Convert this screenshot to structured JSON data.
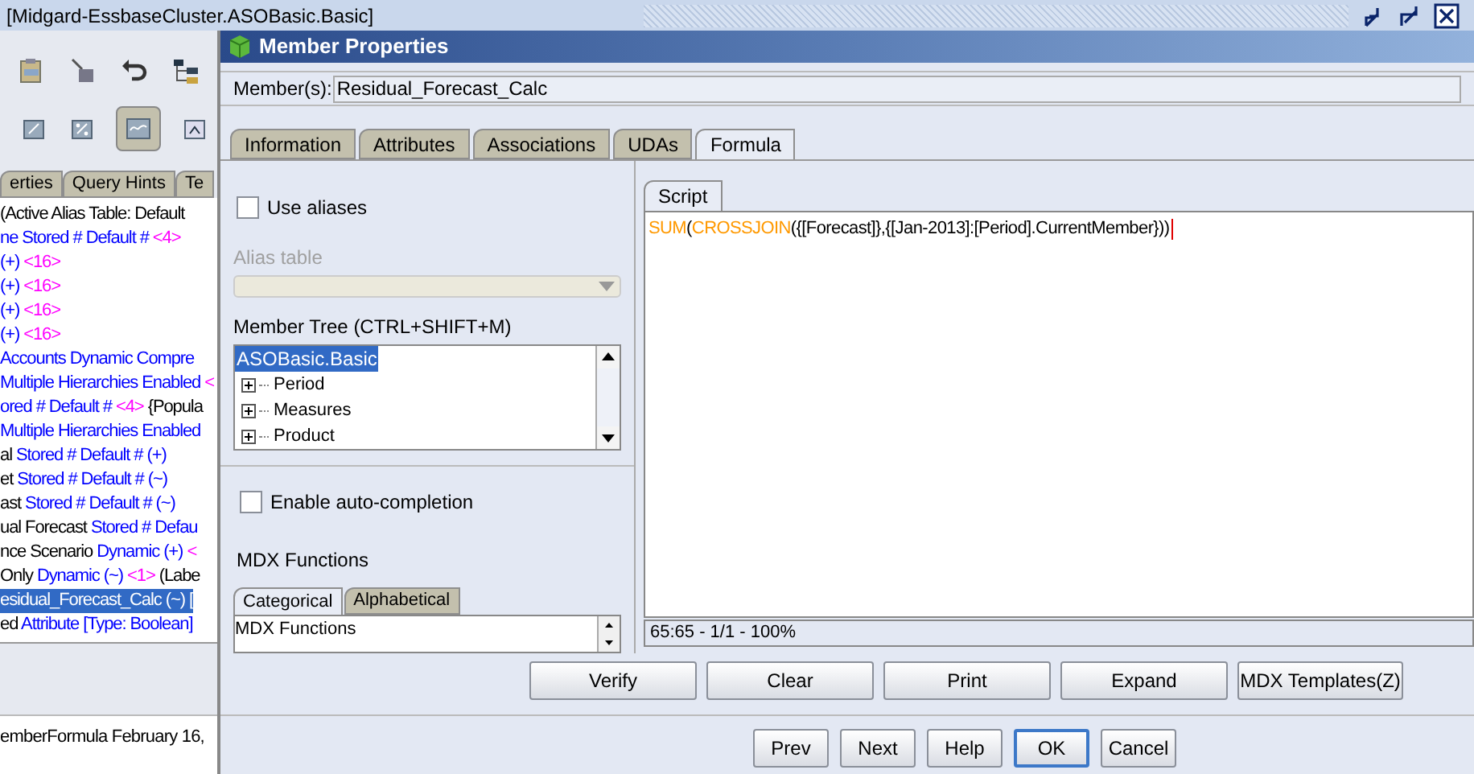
{
  "app": {
    "title": "[Midgard-EssbaseCluster.ASOBasic.Basic]",
    "panel_tabs": [
      {
        "label": "erties",
        "selected": false
      },
      {
        "label": "Query Hints",
        "selected": false
      },
      {
        "label": "Te",
        "selected": false
      }
    ],
    "outline": [
      {
        "selected": false,
        "segments": [
          {
            "text": "(Active Alias Table: Default",
            "color": "#000000"
          }
        ]
      },
      {
        "selected": false,
        "segments": [
          {
            "text": "ne Stored # Default # ",
            "color": "#0000ff"
          },
          {
            "text": "<4>",
            "color": "#ff00ff"
          }
        ]
      },
      {
        "selected": false,
        "segments": [
          {
            "text": "(+) ",
            "color": "#0000ff"
          },
          {
            "text": "<16>",
            "color": "#ff00ff"
          }
        ]
      },
      {
        "selected": false,
        "segments": [
          {
            "text": "(+) ",
            "color": "#0000ff"
          },
          {
            "text": "<16>",
            "color": "#ff00ff"
          }
        ]
      },
      {
        "selected": false,
        "segments": [
          {
            "text": "(+) ",
            "color": "#0000ff"
          },
          {
            "text": "<16>",
            "color": "#ff00ff"
          }
        ]
      },
      {
        "selected": false,
        "segments": [
          {
            "text": "(+) ",
            "color": "#0000ff"
          },
          {
            "text": "<16>",
            "color": "#ff00ff"
          }
        ]
      },
      {
        "selected": false,
        "segments": [
          {
            "text": "Accounts Dynamic  Compre",
            "color": "#0000ff"
          }
        ]
      },
      {
        "selected": false,
        "segments": [
          {
            "text": "Multiple Hierarchies Enabled ",
            "color": "#0000ff"
          },
          {
            "text": "<",
            "color": "#ff00ff"
          }
        ]
      },
      {
        "selected": false,
        "segments": [
          {
            "text": "ored # Default # ",
            "color": "#0000ff"
          },
          {
            "text": "<4>",
            "color": "#ff00ff"
          },
          {
            "text": " {Popula",
            "color": "#000000"
          }
        ]
      },
      {
        "selected": false,
        "segments": [
          {
            "text": "Multiple Hierarchies Enabled",
            "color": "#0000ff"
          }
        ]
      },
      {
        "selected": false,
        "segments": [
          {
            "text": "al ",
            "color": "#000000"
          },
          {
            "text": "Stored # Default # (+)",
            "color": "#0000ff"
          }
        ]
      },
      {
        "selected": false,
        "segments": [
          {
            "text": "et ",
            "color": "#000000"
          },
          {
            "text": "Stored # Default # (~)",
            "color": "#0000ff"
          }
        ]
      },
      {
        "selected": false,
        "segments": [
          {
            "text": "ast ",
            "color": "#000000"
          },
          {
            "text": "Stored # Default # (~)",
            "color": "#0000ff"
          }
        ]
      },
      {
        "selected": false,
        "segments": [
          {
            "text": "ual Forecast ",
            "color": "#000000"
          },
          {
            "text": "Stored # Defau",
            "color": "#0000ff"
          }
        ]
      },
      {
        "selected": false,
        "segments": [
          {
            "text": "nce Scenario ",
            "color": "#000000"
          },
          {
            "text": "Dynamic  (+) ",
            "color": "#0000ff"
          },
          {
            "text": "<",
            "color": "#ff00ff"
          }
        ]
      },
      {
        "selected": false,
        "segments": [
          {
            "text": "Only ",
            "color": "#000000"
          },
          {
            "text": "Dynamic  (~) ",
            "color": "#0000ff"
          },
          {
            "text": "<1>",
            "color": "#ff00ff"
          },
          {
            "text": " (Labe",
            "color": "#000000"
          }
        ]
      },
      {
        "selected": true,
        "segments": [
          {
            "text": "esidual_Forecast_Calc (~) [",
            "color": "#ffffff"
          }
        ]
      },
      {
        "selected": false,
        "segments": [
          {
            "text": "ed ",
            "color": "#000000"
          },
          {
            "text": "Attribute [Type: Boolean]",
            "color": "#0000ff"
          }
        ]
      }
    ],
    "status": "emberFormula February 16,"
  },
  "dialog": {
    "title": "Member Properties",
    "member_label": "Member(s):",
    "member_value": "Residual_Forecast_Calc",
    "tabs": [
      {
        "label": "Information",
        "selected": false
      },
      {
        "label": "Attributes",
        "selected": false
      },
      {
        "label": "Associations",
        "selected": false
      },
      {
        "label": "UDAs",
        "selected": false
      },
      {
        "label": "Formula",
        "selected": true
      }
    ],
    "use_aliases": {
      "label": "Use aliases",
      "checked": false
    },
    "alias_table": {
      "label": "Alias table",
      "disabled": true
    },
    "member_tree": {
      "label": "Member Tree (CTRL+SHIFT+M)",
      "items": [
        {
          "label": "ASOBasic.Basic",
          "selected": true,
          "children": [
            {
              "label": "Period",
              "selected": false,
              "expanded": false
            },
            {
              "label": "Measures",
              "selected": false,
              "expanded": false
            },
            {
              "label": "Product",
              "selected": false,
              "expanded": false
            }
          ]
        }
      ]
    },
    "auto_completion": {
      "label": "Enable auto-completion",
      "checked": false
    },
    "mdx_functions": {
      "label": "MDX Functions",
      "tabs": [
        {
          "label": "Categorical",
          "selected": true
        },
        {
          "label": "Alphabetical",
          "selected": false
        }
      ],
      "items": [
        "MDX Functions"
      ]
    },
    "script_tab": {
      "label": "Script",
      "selected": true
    },
    "formula": [
      {
        "text": "SUM",
        "color": "#ff9900"
      },
      {
        "text": "(",
        "color": "#000000"
      },
      {
        "text": "CROSSJOIN",
        "color": "#ff9900"
      },
      {
        "text": "({[Forecast]},{[Jan-2013]:[Period].CurrentMember}))",
        "color": "#000000"
      }
    ],
    "editor_status": "65:65 - 1/1 - 100%",
    "actions": [
      "Verify",
      "Clear",
      "Print",
      "Expand",
      "MDX Templates(Z)"
    ],
    "nav_buttons": [
      {
        "label": "Prev",
        "default": false
      },
      {
        "label": "Next",
        "default": false
      },
      {
        "label": "Help",
        "default": false
      },
      {
        "label": "OK",
        "default": true
      },
      {
        "label": "Cancel",
        "default": false
      }
    ]
  }
}
